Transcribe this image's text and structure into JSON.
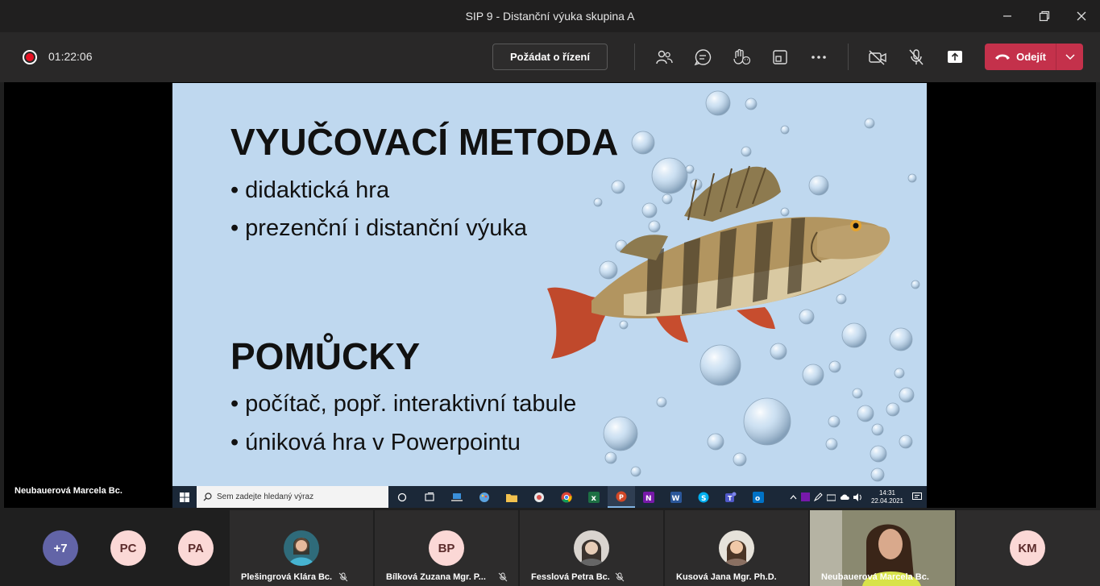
{
  "window": {
    "title": "SIP 9 - Distanční výuka skupina A",
    "minimize": "—",
    "maximize": "❐",
    "close": "✕"
  },
  "toolbar": {
    "timer": "01:22:06",
    "request_control": "Požádat o řízení",
    "leave": "Odejít"
  },
  "slide": {
    "heading1": "VYUČOVACÍ METODA",
    "methods": [
      "didaktická hra",
      "prezenční i distanční výuka"
    ],
    "heading2": "POMŮCKY",
    "aids": [
      "počítač, popř. interaktivní tabule",
      "úniková hra v Powerpointu"
    ],
    "bullet": "•"
  },
  "presenter": {
    "name": "Neubauerová Marcela Bc."
  },
  "taskbar": {
    "search_placeholder": "Sem zadejte hledaný výraz",
    "time": "14:31",
    "date": "22.04.2021"
  },
  "participants": {
    "overflow": "+7",
    "small": [
      "PC",
      "PA"
    ],
    "tiles": [
      {
        "name": "Plešingrová Klára Bc.",
        "initials": ""
      },
      {
        "name": "Bílková Zuzana Mgr. P...",
        "initials": "BP"
      },
      {
        "name": "Fesslová Petra Bc.",
        "initials": ""
      },
      {
        "name": "Kusová Jana Mgr. Ph.D.",
        "initials": ""
      },
      {
        "name": "Neubauerová Marcela Bc.",
        "initials": ""
      },
      {
        "name": "",
        "initials": "KM"
      }
    ]
  },
  "colors": {
    "leave_red": "#c4314b",
    "avatar_purple": "#6264a7",
    "slide_bg": "#bfd8ef"
  }
}
